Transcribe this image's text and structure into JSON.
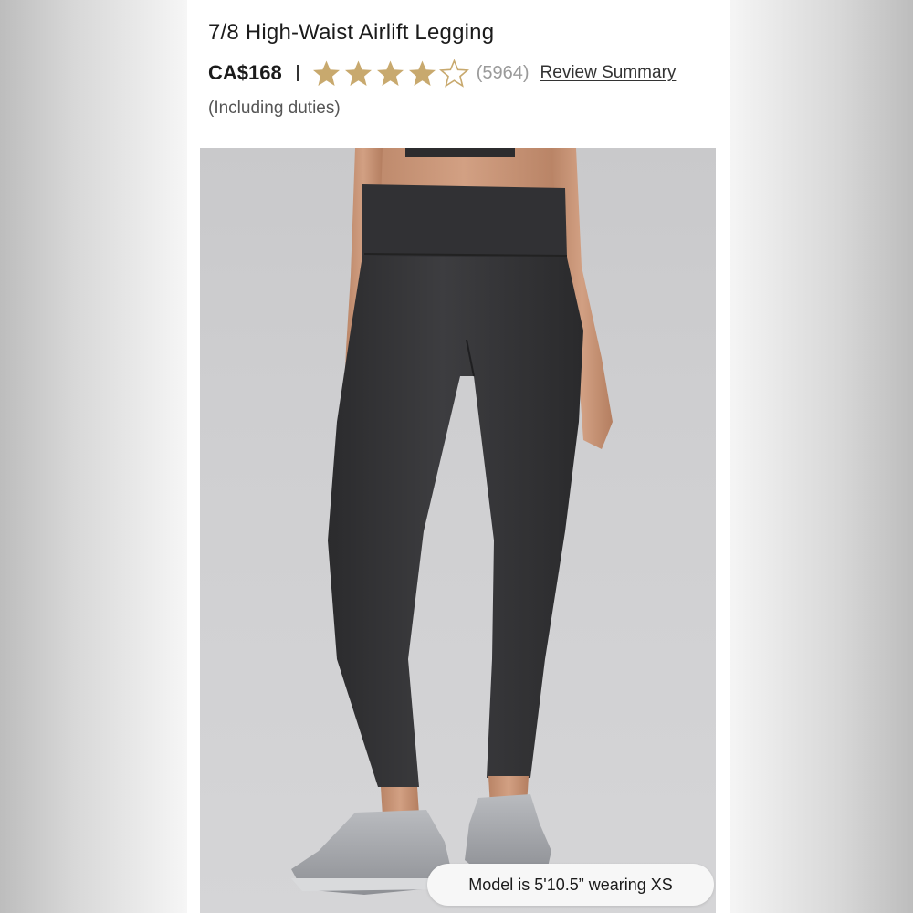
{
  "product": {
    "title": "7/8 High-Waist Airlift Legging",
    "price": "CA$168",
    "divider": "|",
    "rating": {
      "value": 4,
      "max": 5,
      "count_text": "(5964)"
    },
    "review_link": "Review Summary",
    "duties_note": "(Including duties)"
  },
  "image": {
    "subject": "black high-waist leggings on model with grey sneakers",
    "model_caption": "Model is 5'10.5” wearing XS"
  },
  "colors": {
    "star_fill": "#c8a96e",
    "text_primary": "#1b1b1b",
    "text_muted": "#9a9a9a"
  }
}
